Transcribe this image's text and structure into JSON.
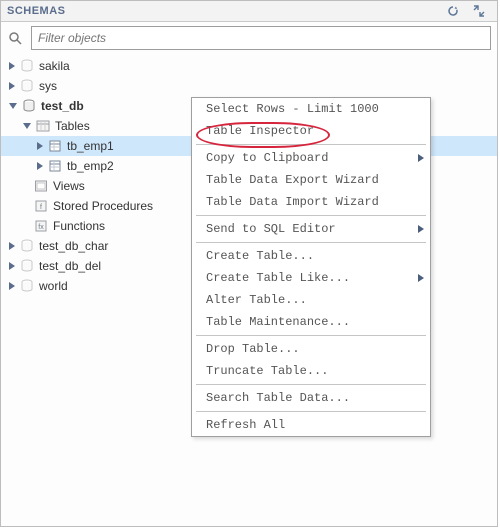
{
  "header": {
    "title": "SCHEMAS"
  },
  "filter": {
    "placeholder": "Filter objects"
  },
  "tree": {
    "sakila": "sakila",
    "sys": "sys",
    "test_db": "test_db",
    "tables": "Tables",
    "tb_emp1": "tb_emp1",
    "tb_emp2": "tb_emp2",
    "views": "Views",
    "stored_procedures": "Stored Procedures",
    "functions": "Functions",
    "test_db_char": "test_db_char",
    "test_db_del": "test_db_del",
    "world": "world"
  },
  "menu": {
    "select_rows": "Select Rows - Limit 1000",
    "table_inspector": "Table Inspector",
    "copy_clipboard": "Copy to Clipboard",
    "export_wizard": "Table Data Export Wizard",
    "import_wizard": "Table Data Import Wizard",
    "send_sql": "Send to SQL Editor",
    "create_table": "Create Table...",
    "create_table_like": "Create Table Like...",
    "alter_table": "Alter Table...",
    "table_maintenance": "Table Maintenance...",
    "drop_table": "Drop Table...",
    "truncate_table": "Truncate Table...",
    "search_table_data": "Search Table Data...",
    "refresh_all": "Refresh All"
  }
}
